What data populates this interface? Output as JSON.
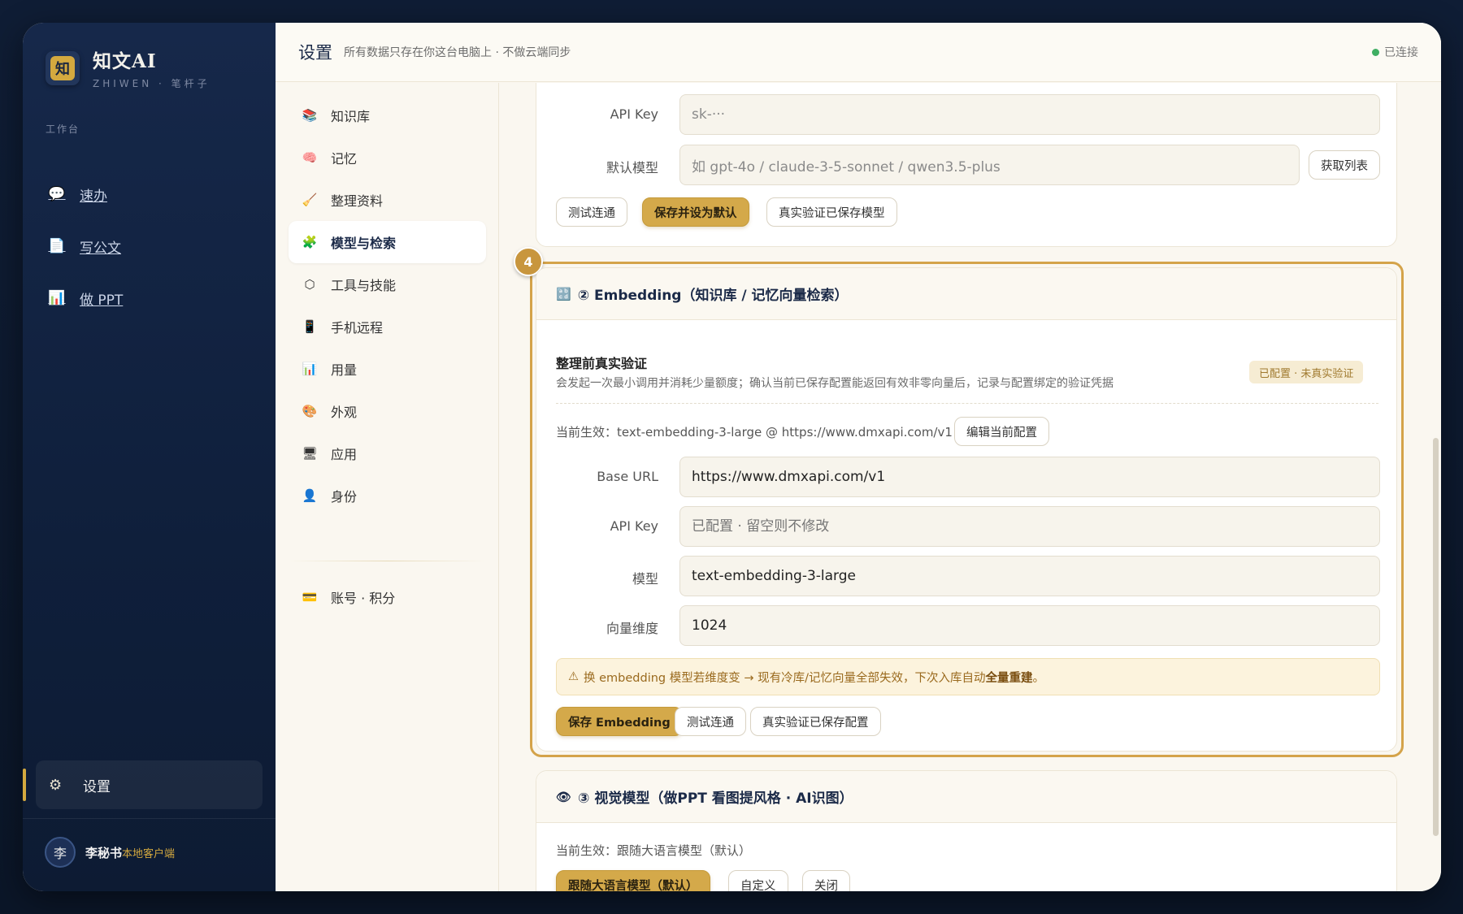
{
  "brand": {
    "logo_char": "知",
    "title": "知文AI",
    "subtitle": "ZHIWEN · 笔杆子"
  },
  "sidebar": {
    "section_label": "工作台",
    "items": [
      {
        "label": "速办",
        "icon": "speech-bubble-icon",
        "glyph": "💬"
      },
      {
        "label": "写公文",
        "icon": "document-icon",
        "glyph": "📄"
      },
      {
        "label": "做 PPT",
        "icon": "bar-chart-icon",
        "glyph": "📊"
      }
    ],
    "settings": {
      "label": "设置",
      "icon": "gear-icon",
      "glyph": "⚙"
    },
    "user": {
      "avatar": "李",
      "name": "李秘书",
      "tag": "本地客户端"
    }
  },
  "topbar": {
    "title": "设置",
    "subtitle": "所有数据只存在你这台电脑上 · 不做云端同步",
    "status": "已连接"
  },
  "subnav": {
    "items": [
      {
        "label": "知识库",
        "icon": "books-icon",
        "glyph": "📚"
      },
      {
        "label": "记忆",
        "icon": "brain-icon",
        "glyph": "🧠"
      },
      {
        "label": "整理资料",
        "icon": "broom-icon",
        "glyph": "🧹"
      },
      {
        "label": "模型与检索",
        "icon": "puzzle-icon",
        "glyph": "🧩",
        "active": true
      },
      {
        "label": "工具与技能",
        "icon": "hexagon-icon",
        "glyph": "⬡"
      },
      {
        "label": "手机远程",
        "icon": "phone-icon",
        "glyph": "📱"
      },
      {
        "label": "用量",
        "icon": "bar-chart-icon",
        "glyph": "📊"
      },
      {
        "label": "外观",
        "icon": "palette-icon",
        "glyph": "🎨"
      },
      {
        "label": "应用",
        "icon": "monitor-icon",
        "glyph": "🖥"
      },
      {
        "label": "身份",
        "icon": "person-icon",
        "glyph": "👤"
      }
    ],
    "account": {
      "label": "账号 · 积分",
      "icon": "credit-card-icon",
      "glyph": "💳"
    }
  },
  "llm_card": {
    "api_key_label": "API Key",
    "api_key_value": "sk-···",
    "default_model_label": "默认模型",
    "default_model_placeholder": "如 gpt-4o / claude-3-5-sonnet / qwen3.5-plus",
    "fetch_list": "获取列表",
    "test_btn": "测试连通",
    "save_default_btn": "保存并设为默认",
    "verify_btn": "真实验证已保存模型"
  },
  "embedding_card": {
    "step": "4",
    "icon_glyph": "🔡",
    "title": "② Embedding（知识库 / 记忆向量检索）",
    "verify_title": "整理前真实验证",
    "verify_desc": "会发起一次最小调用并消耗少量额度；确认当前已保存配置能返回有效非零向量后，记录与配置绑定的验证凭据",
    "status_tag": "已配置 · 未真实验证",
    "current_label": "当前生效：",
    "current_value": "text-embedding-3-large @ https://www.dmxapi.com/v1",
    "edit_btn": "编辑当前配置",
    "fields": [
      {
        "label": "Base URL",
        "value": "https://www.dmxapi.com/v1",
        "placeholder": ""
      },
      {
        "label": "API Key",
        "value": "",
        "placeholder": "已配置 · 留空则不修改"
      },
      {
        "label": "模型",
        "value": "text-embedding-3-large",
        "placeholder": ""
      },
      {
        "label": "向量维度",
        "value": "1024",
        "placeholder": ""
      }
    ],
    "warning_icon": "⚠",
    "warning_text": "换 embedding 模型若维度变 → 现有冷库/记忆向量全部失效，下次入库自动",
    "warning_bold": "全量重建",
    "warning_end": "。",
    "save_btn": "保存 Embedding",
    "test_btn": "测试连通",
    "verify_btn": "真实验证已保存配置"
  },
  "vision_card": {
    "icon_glyph": "👁",
    "title": "③ 视觉模型（做PPT 看图提风格 · AI识图）",
    "current_label": "当前生效：",
    "current_value": "跟随大语言模型（默认）",
    "options": [
      "跟随大语言模型（默认）",
      "自定义",
      "关闭"
    ]
  }
}
